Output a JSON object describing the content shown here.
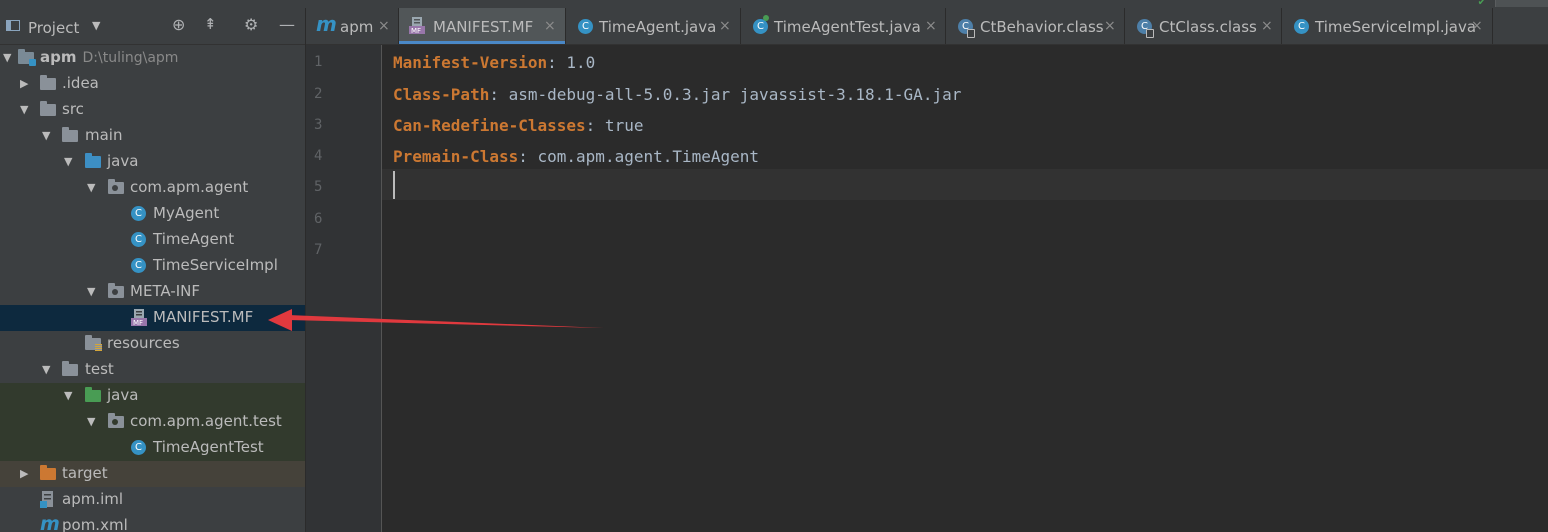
{
  "project_panel": {
    "title": "Project",
    "tree": [
      {
        "name": "root",
        "label": "apm",
        "path": "D:\\tuling\\apm"
      },
      {
        "name": "idea",
        "label": ".idea"
      },
      {
        "name": "src",
        "label": "src"
      },
      {
        "name": "main",
        "label": "main"
      },
      {
        "name": "main-java",
        "label": "java"
      },
      {
        "name": "pkg-agent",
        "label": "com.apm.agent"
      },
      {
        "name": "myagent",
        "label": "MyAgent"
      },
      {
        "name": "timeagent",
        "label": "TimeAgent"
      },
      {
        "name": "timeserviceimpl",
        "label": "TimeServiceImpl"
      },
      {
        "name": "meta-inf",
        "label": "META-INF"
      },
      {
        "name": "manifest",
        "label": "MANIFEST.MF"
      },
      {
        "name": "resources",
        "label": "resources"
      },
      {
        "name": "test",
        "label": "test"
      },
      {
        "name": "test-java",
        "label": "java"
      },
      {
        "name": "pkg-test",
        "label": "com.apm.agent.test"
      },
      {
        "name": "timeagenttest",
        "label": "TimeAgentTest"
      },
      {
        "name": "target",
        "label": "target"
      },
      {
        "name": "apm-iml",
        "label": "apm.iml"
      },
      {
        "name": "pom",
        "label": "pom.xml"
      }
    ]
  },
  "tabs": [
    {
      "label": "apm",
      "icon": "maven-m-icon",
      "active": false
    },
    {
      "label": "MANIFEST.MF",
      "icon": "manifest-file-icon",
      "active": true
    },
    {
      "label": "TimeAgent.java",
      "icon": "class-icon",
      "active": false
    },
    {
      "label": "TimeAgentTest.java",
      "icon": "test-class-icon",
      "active": false
    },
    {
      "label": "CtBehavior.class",
      "icon": "compiled-class-icon",
      "active": false
    },
    {
      "label": "CtClass.class",
      "icon": "compiled-class-icon",
      "active": false
    },
    {
      "label": "TimeServiceImpl.java",
      "icon": "class-icon",
      "active": false
    }
  ],
  "tab_close_glyph": "×",
  "editor": {
    "line_numbers": [
      "1",
      "2",
      "3",
      "4",
      "5",
      "6",
      "7"
    ],
    "lines": [
      {
        "key": "Manifest-Version",
        "value": " 1.0"
      },
      {
        "key": "Class-Path",
        "value": " asm-debug-all-5.0.3.jar javassist-3.18.1-GA.jar"
      },
      {
        "key": "Can-Redefine-Classes",
        "value": " true"
      },
      {
        "key": "Premain-Class",
        "value": " com.apm.agent.TimeAgent"
      }
    ],
    "separator": ":"
  },
  "colors": {
    "accent": "#4a88c7",
    "keyword": "#cc7832",
    "arrow": "#e0393e",
    "selection": "#0d293e"
  }
}
